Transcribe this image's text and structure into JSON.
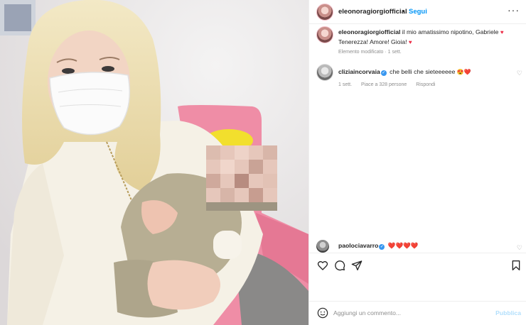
{
  "post": {
    "photo_description_icon": "post-photo",
    "colors": {
      "link_blue": "#0095f6",
      "heart_red": "#ed2b45",
      "muted": "#8e8e8e"
    }
  },
  "header": {
    "username": "eleonoragiorgiofficial",
    "separator": "•",
    "follow_label": "Segui",
    "more_icon": "more-horizontal-icon",
    "more_glyph": "···"
  },
  "caption": {
    "username": "eleonoragiorgiofficial",
    "text_line1": "il mio amatissimo nipotino, Gabriele",
    "text_line2": "Tenerezza! Amore! Gioia!",
    "heart": "♥",
    "meta": "Elemento modificato · 1 sett."
  },
  "comments": [
    {
      "username": "cliziaincorvaia",
      "verified_glyph": "✓",
      "text": "che belli che sieteeeeee",
      "emojis": "😍❤️",
      "time": "1 sett.",
      "likes": "Piace a 328 persone",
      "reply": "Rispondi",
      "like_glyph": "♡"
    },
    {
      "username": "paolociavarro",
      "verified_glyph": "✓",
      "hearts": "❤️❤️❤️❤️",
      "like_glyph": "♡"
    }
  ],
  "actions": {
    "like_icon": "heart-outline-icon",
    "comment_icon": "comment-bubble-icon",
    "share_icon": "paper-plane-icon",
    "save_icon": "bookmark-icon"
  },
  "add_comment": {
    "emoji_icon": "smiley-icon",
    "placeholder": "Aggiungi un commento...",
    "publish_label": "Pubblica"
  }
}
